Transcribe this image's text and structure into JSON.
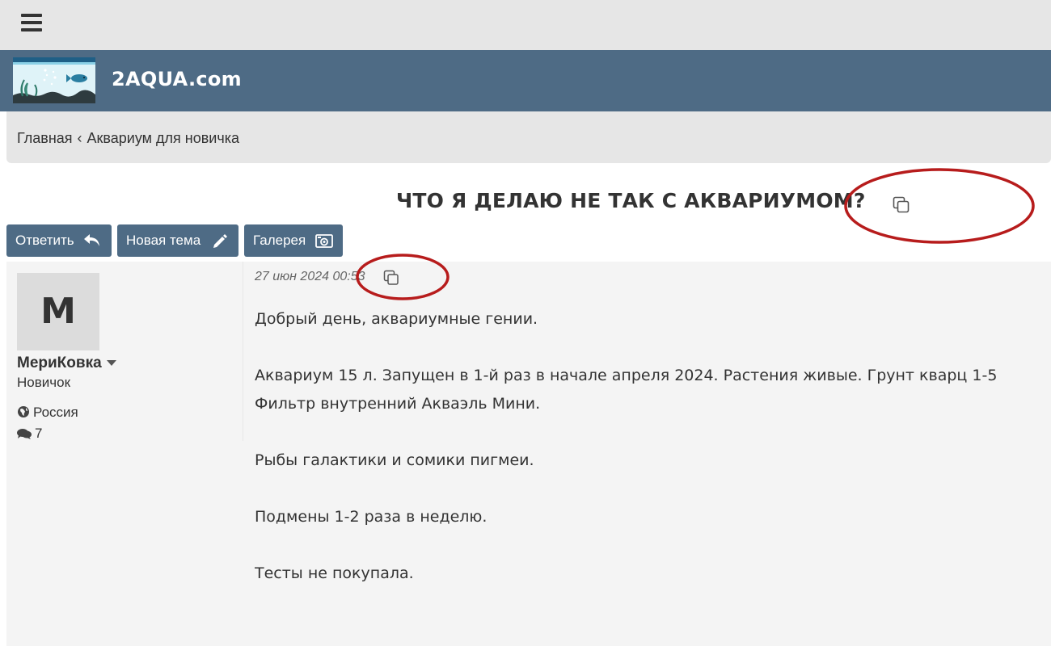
{
  "site": {
    "name": "2AQUA.com"
  },
  "breadcrumb": {
    "items": [
      "Главная",
      "Аквариум для новичка"
    ],
    "separator": "‹"
  },
  "topic": {
    "title": "ЧТО Я ДЕЛАЮ НЕ ТАК С АКВАРИУМОМ?"
  },
  "actions": {
    "reply_label": "Ответить",
    "new_topic_label": "Новая тема",
    "gallery_label": "Галерея"
  },
  "post": {
    "author": {
      "avatar_letter": "M",
      "name": "МериКовка",
      "rank": "Новичок",
      "country": "Россия",
      "post_count": "7"
    },
    "date": "27 июн 2024 00:53",
    "body": {
      "p1": "Добрый день, аквариумные гении.",
      "p2_line1": "Аквариум 15 л. Запущен в 1-й раз в начале апреля 2024. Растения живые. Грунт кварц 1-5",
      "p2_line2": "Фильтр внутренний Акваэль Мини.",
      "p3": "Рыбы галактики и сомики пигмеи.",
      "p4": "Подмены 1-2 раза в неделю.",
      "p5": "Тесты не покупала."
    }
  },
  "colors": {
    "brand": "#4e6b85",
    "annotation": "#b71c1c",
    "topbar": "#e6e6e6"
  },
  "icons": [
    "hamburger-menu-icon",
    "reply-arrow-icon",
    "pencil-icon",
    "camera-icon",
    "copy-icon",
    "globe-icon",
    "comments-icon",
    "caret-down-icon"
  ]
}
